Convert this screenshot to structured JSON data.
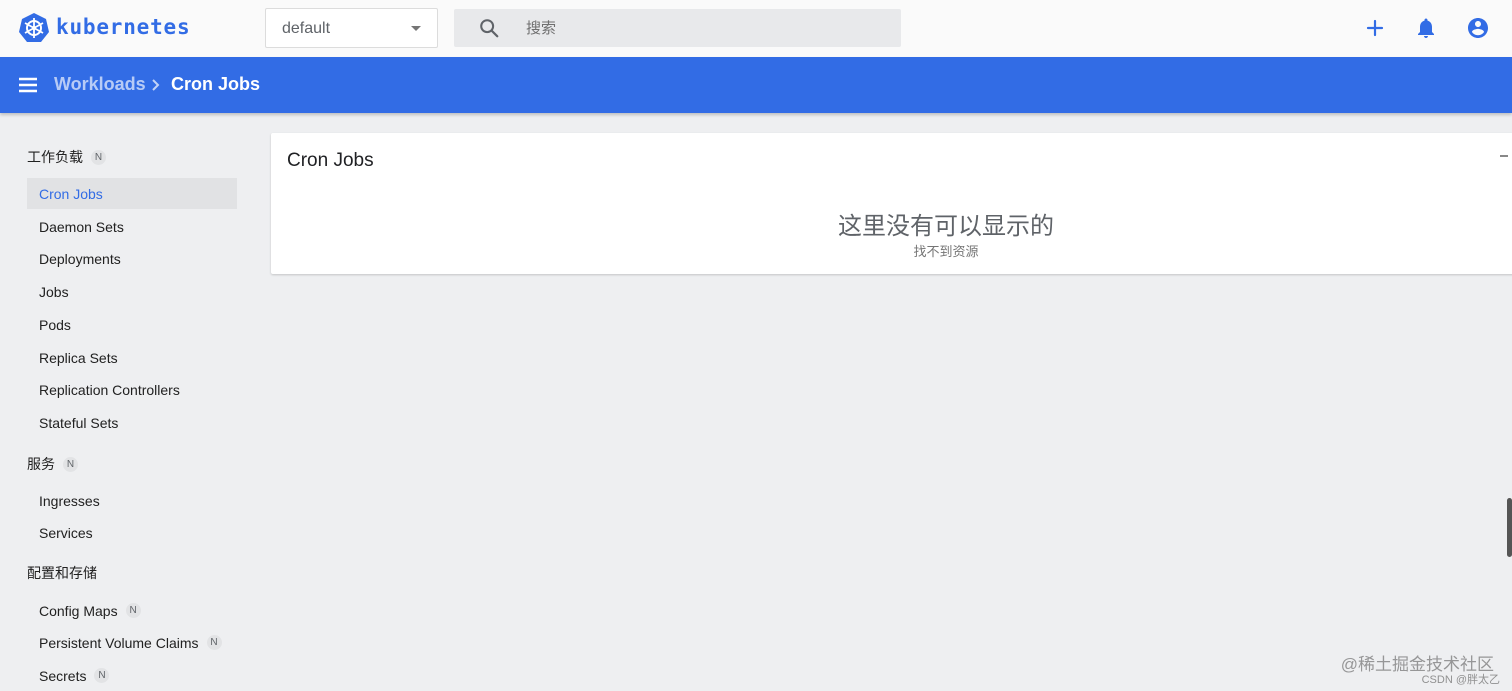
{
  "app": {
    "brand": "kubernetes"
  },
  "namespace": {
    "value": "default"
  },
  "search": {
    "placeholder": "搜索"
  },
  "breadcrumb": {
    "parent": "Workloads",
    "current": "Cron Jobs"
  },
  "sidebar": {
    "groups": [
      {
        "label": "工作负载",
        "badge": "N"
      },
      {
        "label": "服务",
        "badge": "N"
      },
      {
        "label": "配置和存储"
      }
    ],
    "items": [
      {
        "label": "Cron Jobs",
        "active": true
      },
      {
        "label": "Daemon Sets"
      },
      {
        "label": "Deployments"
      },
      {
        "label": "Jobs"
      },
      {
        "label": "Pods"
      },
      {
        "label": "Replica Sets"
      },
      {
        "label": "Replication Controllers"
      },
      {
        "label": "Stateful Sets"
      },
      {
        "label": "Ingresses"
      },
      {
        "label": "Services"
      },
      {
        "label": "Config Maps",
        "badge": "N"
      },
      {
        "label": "Persistent Volume Claims",
        "badge": "N"
      },
      {
        "label": "Secrets",
        "badge": "N"
      }
    ]
  },
  "main": {
    "card_title": "Cron Jobs",
    "empty_title": "这里没有可以显示的",
    "empty_subtitle": "找不到资源"
  },
  "watermark": {
    "line1": "@稀土掘金技术社区",
    "line2": "CSDN @胖太乙"
  },
  "icons": {
    "logo": "kubernetes-helm-icon",
    "search": "search-icon",
    "add": "plus-icon",
    "notifications": "bell-icon",
    "account": "account-circle-icon",
    "menu": "hamburger-menu-icon",
    "breadcrumb_separator": "chevron-right-icon"
  },
  "colors": {
    "primary": "#326ce5",
    "background": "#eeeff1",
    "active_item": "#e1e2e4"
  }
}
